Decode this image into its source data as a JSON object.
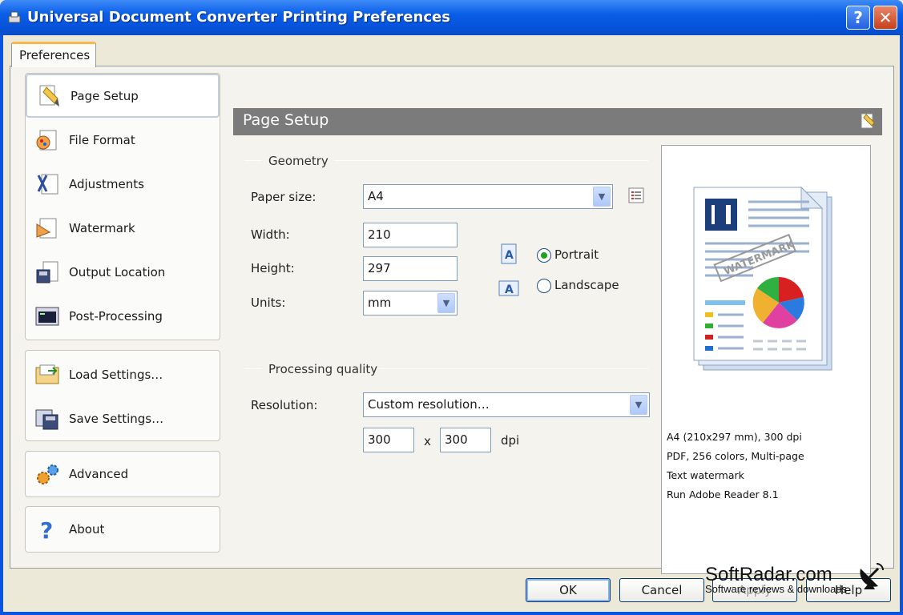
{
  "window": {
    "title": "Universal Document Converter Printing Preferences",
    "help_btn": "?",
    "close_btn": "✕"
  },
  "tab": {
    "label": "Preferences"
  },
  "sidebar": {
    "items": [
      {
        "label": "Page Setup",
        "icon": "page-setup-icon"
      },
      {
        "label": "File Format",
        "icon": "file-format-icon"
      },
      {
        "label": "Adjustments",
        "icon": "adjustments-icon"
      },
      {
        "label": "Watermark",
        "icon": "watermark-icon"
      },
      {
        "label": "Output Location",
        "icon": "output-location-icon"
      },
      {
        "label": "Post-Processing",
        "icon": "post-processing-icon"
      }
    ],
    "settings": [
      {
        "label": "Load Settings…",
        "icon": "load-settings-icon"
      },
      {
        "label": "Save Settings…",
        "icon": "save-settings-icon"
      }
    ],
    "advanced": {
      "label": "Advanced"
    },
    "about": {
      "label": "About"
    }
  },
  "content": {
    "header": "Page Setup",
    "geometry": {
      "section": "Geometry",
      "paper_size_label": "Paper size:",
      "paper_size_value": "A4",
      "width_label": "Width:",
      "width_value": "210",
      "height_label": "Height:",
      "height_value": "297",
      "units_label": "Units:",
      "units_value": "mm",
      "orientation": {
        "portrait": "Portrait",
        "landscape": "Landscape",
        "selected": "Portrait"
      }
    },
    "quality": {
      "section": "Processing quality",
      "resolution_label": "Resolution:",
      "resolution_value": "Custom resolution…",
      "res_x": "300",
      "times": "x",
      "res_y": "300",
      "unit": "dpi"
    },
    "preview": {
      "watermark_text": "WATERMARK",
      "lines": [
        "A4 (210x297 mm), 300 dpi",
        "PDF, 256 colors, Multi-page",
        "Text watermark",
        "Run Adobe Reader 8.1"
      ]
    }
  },
  "buttons": {
    "ok": "OK",
    "cancel": "Cancel",
    "apply": "Apply",
    "help": "Help"
  },
  "branding": {
    "site": "SoftRadar.com",
    "tagline": "Software reviews & downloads"
  }
}
